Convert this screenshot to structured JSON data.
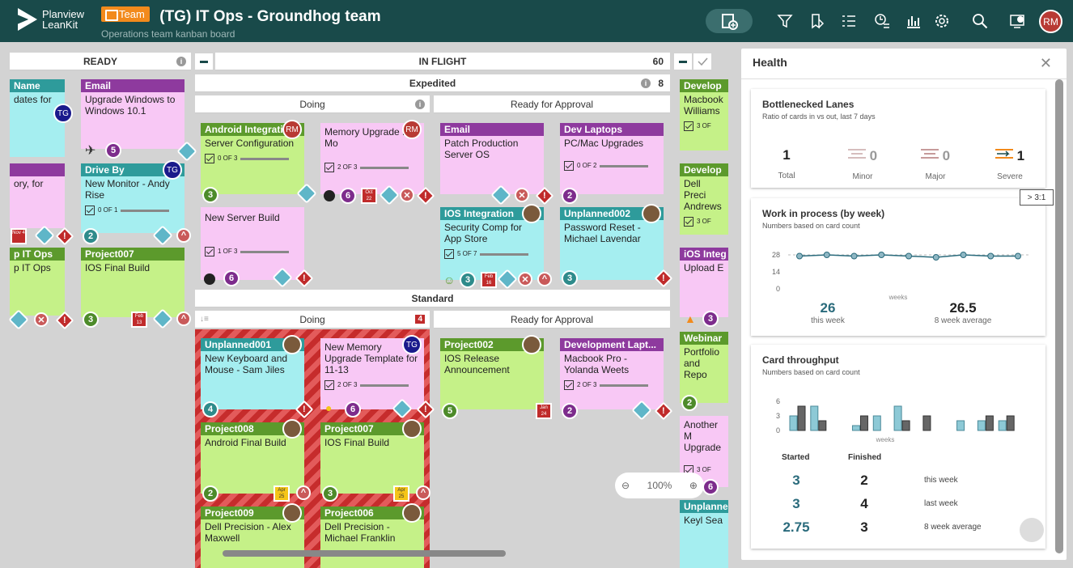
{
  "topbar": {
    "logo_line1": "Planview",
    "logo_line2": "LeanKit",
    "team_badge": "Team",
    "board_title": "(TG) IT Ops - Groundhog team",
    "board_subtitle": "Operations team kanban board",
    "user_initials": "RM",
    "icons": [
      "new-card-icon",
      "filter-icon",
      "bookmark-icon",
      "list-icon",
      "timeline-icon",
      "analytics-icon",
      "settings-icon",
      "search-icon",
      "notifications-icon"
    ]
  },
  "board": {
    "ready": {
      "title": "READY"
    },
    "inflight": {
      "title": "IN FLIGHT",
      "count": "60"
    },
    "expedited": {
      "title": "Expedited",
      "count": "8",
      "doing": "Doing",
      "approval": "Ready for Approval"
    },
    "standard": {
      "title": "Standard",
      "doing": "Doing",
      "doing_count": "4",
      "approval": "Ready for Approval"
    },
    "zoom": "100%"
  },
  "cards": {
    "r1": {
      "header": "Name",
      "line": "dates for",
      "av": "TG"
    },
    "r2": {
      "header": "Email",
      "title": "Upgrade Windows to Windows 10.1",
      "size": "5"
    },
    "r3": {
      "title": "ory, for",
      "date": "Nov 4"
    },
    "r4": {
      "header": "Drive By",
      "title": "New Monitor - Andy Rise",
      "progress": "0 OF 1",
      "size": "2",
      "av": "TG"
    },
    "r5": {
      "header": "p IT Ops",
      "title": "p IT Ops"
    },
    "r6": {
      "header": "Project007",
      "title": "IOS Final Build",
      "size": "3",
      "date": "Feb 13"
    },
    "e1": {
      "header": "Android Integration",
      "title": "Server Configuration",
      "progress": "0 OF 3",
      "size": "3",
      "av": "RM"
    },
    "e2": {
      "title": "Memory Upgrade for Mo",
      "progress": "2 OF 3",
      "size": "6",
      "date": "Oct 22",
      "av": "RM"
    },
    "e3": {
      "title": "New Server Build",
      "progress": "1 OF 3",
      "size": "6"
    },
    "e4": {
      "header": "Email",
      "title": "Patch Production Server OS"
    },
    "e5": {
      "header": "IOS Integration",
      "title": "Security Comp for App Store",
      "progress": "5 OF 7",
      "size": "3",
      "date": "Feb 16"
    },
    "e6": {
      "header": "Dev Laptops",
      "title": "PC/Mac Upgrades",
      "progress": "0 OF 2",
      "size": "2"
    },
    "e7": {
      "header": "Unplanned002",
      "title": "Password Reset - Michael Lavendar",
      "size": "3"
    },
    "s1": {
      "header": "Unplanned001",
      "title": "New Keyboard and Mouse - Sam Jiles",
      "size": "4"
    },
    "s2": {
      "title": "New Memory Upgrade Template for 11-13",
      "progress": "2 OF 3",
      "size": "6",
      "av": "TG"
    },
    "s3": {
      "header": "Project008",
      "title": "Android Final Build",
      "size": "2",
      "date": "Apr 25"
    },
    "s4": {
      "header": "Project007",
      "title": "IOS Final Build",
      "size": "3",
      "date": "Apr 25"
    },
    "s5": {
      "header": "Project009",
      "title": "Dell Precision - Alex Maxwell"
    },
    "s6": {
      "header": "Project006",
      "title": "Dell Precision - Michael Franklin"
    },
    "s7": {
      "header": "Project002",
      "title": "IOS Release Announcement",
      "size": "5",
      "date": "Jan 24"
    },
    "s8": {
      "header": "Development Lapt...",
      "title": "Macbook Pro - Yolanda Weets",
      "progress": "2 OF 3",
      "size": "2"
    },
    "d1": {
      "header": "Develop",
      "title": "Macbook Williams",
      "progress": "3 OF"
    },
    "d2": {
      "header": "Develop",
      "title": "Dell Preci Andrews",
      "progress": "3 OF"
    },
    "d3": {
      "header": "iOS Integ",
      "title": "Upload E",
      "size": "3"
    },
    "d4": {
      "header": "Webinar",
      "title": "Portfolio and Repo",
      "size": "2"
    },
    "d5": {
      "title": "Another M Upgrade",
      "progress": "3 OF",
      "size": "6"
    },
    "d6": {
      "header": "Unplanne",
      "title": "Keyl Sea"
    }
  },
  "health": {
    "title": "Health",
    "bottleneck": {
      "title": "Bottlenecked Lanes",
      "subtitle": "Ratio of cards in vs out, last 7 days",
      "total": "1",
      "total_label": "Total",
      "minor": "0",
      "minor_label": "Minor",
      "major": "0",
      "major_label": "Major",
      "severe": "1",
      "severe_label": "Severe",
      "tooltip": "> 3:1"
    },
    "wip": {
      "title": "Work in process (by week)",
      "subtitle": "Numbers based on card count",
      "y_ticks": [
        "28",
        "14",
        "0"
      ],
      "x_label": "weeks",
      "this_week": "26",
      "this_week_label": "this week",
      "avg": "26.5",
      "avg_label": "8 week average"
    },
    "throughput": {
      "title": "Card throughput",
      "subtitle": "Numbers based on card count",
      "y_ticks": [
        "6",
        "3",
        "0"
      ],
      "x_label": "weeks",
      "started_label": "Started",
      "finished_label": "Finished",
      "rows": [
        {
          "started": "3",
          "finished": "2",
          "label": "this week"
        },
        {
          "started": "3",
          "finished": "4",
          "label": "last week"
        },
        {
          "started": "2.75",
          "finished": "3",
          "label": "8 week average"
        }
      ]
    }
  },
  "chart_data": [
    {
      "type": "line",
      "title": "Work in process (by week)",
      "xlabel": "weeks",
      "ylabel": "",
      "ylim": [
        0,
        28
      ],
      "x": [
        1,
        2,
        3,
        4,
        5,
        6,
        7,
        8,
        9
      ],
      "series": [
        {
          "values": [
            27,
            28,
            27,
            28,
            27,
            26,
            28,
            27,
            27
          ]
        }
      ]
    },
    {
      "type": "bar",
      "title": "Card throughput",
      "xlabel": "weeks",
      "ylim": [
        0,
        7
      ],
      "categories": [
        "1",
        "2",
        "3",
        "4",
        "5",
        "6",
        "7",
        "8",
        "9",
        "10",
        "11"
      ],
      "series": [
        {
          "name": "Started",
          "values": [
            3,
            5,
            0,
            1,
            3,
            5,
            0,
            0,
            2,
            2,
            2
          ]
        },
        {
          "name": "Finished",
          "values": [
            5,
            2,
            0,
            3,
            0,
            2,
            3,
            0,
            0,
            3,
            3
          ]
        }
      ]
    }
  ]
}
